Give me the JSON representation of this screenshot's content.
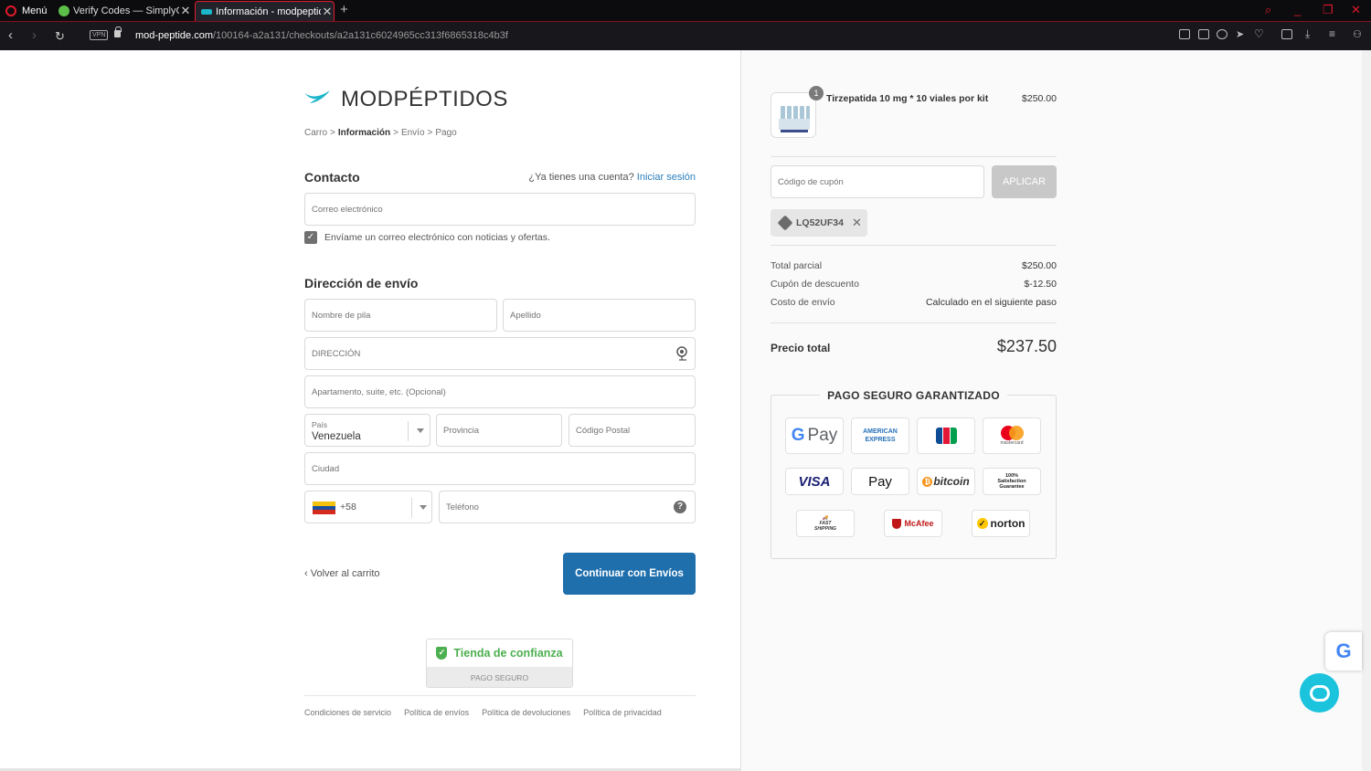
{
  "browser": {
    "menu_label": "Menú",
    "tabs": [
      {
        "title": "Verify Codes — SimplyCodes",
        "active": false
      },
      {
        "title": "Información - modpeptides",
        "active": true
      }
    ],
    "url_host": "mod-peptide.com",
    "url_path": "/100164-a2a131/checkouts/a2a131c6024965cc313f6865318c4b3f",
    "vpn_label": "VPN"
  },
  "store": {
    "name": "MODPÉPTIDOS",
    "brand_color": "#1cb5c9"
  },
  "breadcrumb": [
    "Carro",
    ">",
    "Información",
    ">",
    "Envío",
    ">",
    "Pago"
  ],
  "contact": {
    "heading": "Contacto",
    "have_account": "¿Ya tienes una cuenta?",
    "login_link": "Iniciar sesión",
    "email_placeholder": "Correo electrónico",
    "newsletter_label": "Envíame un correo electrónico con noticias y ofertas.",
    "newsletter_checked": true
  },
  "shipping": {
    "heading": "Dirección de envío",
    "first_name": "Nombre de pila",
    "last_name": "Apellido",
    "address": "DIRECCIÓN",
    "apartment": "Apartamento, suite, etc. (Opcional)",
    "country_label": "País",
    "country_value": "Venezuela",
    "province": "Provincia",
    "postal": "Código Postal",
    "city": "Ciudad",
    "phone_code": "+58",
    "phone": "Teléfono"
  },
  "actions": {
    "back": "Volver al carrito",
    "continue": "Continuar con Envíos"
  },
  "trust": {
    "title": "Tienda de confianza",
    "subtitle": "PAGO SEGURO"
  },
  "footer_links": [
    "Condiciones de servicio",
    "Política de envíos",
    "Política de devoluciones",
    "Política de privacidad"
  ],
  "order": {
    "quantity": "1",
    "product_name": "Tirzepatida 10 mg * 10 viales por kit",
    "product_price": "$250.00",
    "coupon_placeholder": "Código de cupón",
    "apply_label": "APLICAR",
    "applied_code": "LQ52UF34",
    "rows": [
      {
        "label": "Total parcial",
        "value": "$250.00"
      },
      {
        "label": "Cupón de descuento",
        "value": "$-12.50"
      },
      {
        "label": "Costo de envío",
        "value": "Calculado en el siguiente paso"
      }
    ],
    "total_label": "Precio total",
    "total_value": "$237.50"
  },
  "secure": {
    "title": "PAGO SEGURO GARANTIZADO",
    "badges": [
      "G Pay",
      "AMERICAN EXPRESS",
      "JCB",
      "mastercard",
      "VISA",
      "Pay",
      "bitcoin",
      "100% Satisfaction Guarantee",
      "FAST SHIPPING",
      "McAfee",
      "norton"
    ]
  }
}
